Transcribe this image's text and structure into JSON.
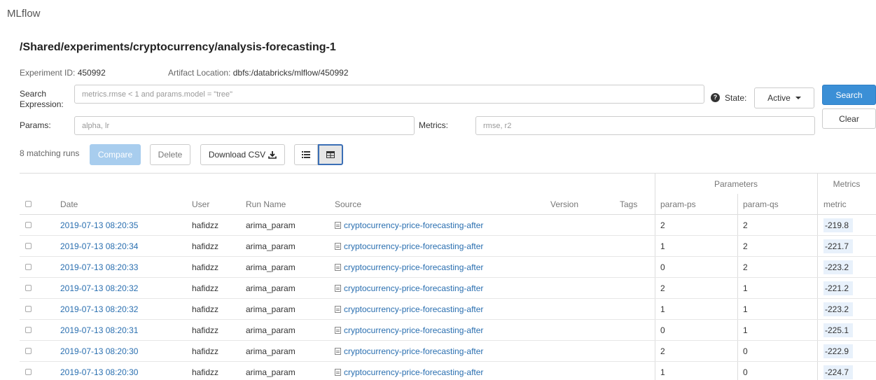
{
  "app": {
    "title": "MLflow"
  },
  "experiment": {
    "path": "/Shared/experiments/cryptocurrency/analysis-forecasting-1",
    "id_label": "Experiment ID:",
    "id_value": "450992",
    "artifact_label": "Artifact Location:",
    "artifact_value": "dbfs:/databricks/mlflow/450992"
  },
  "search": {
    "expression_label_1": "Search",
    "expression_label_2": "Expression:",
    "expression_placeholder": "metrics.rmse < 1 and params.model = \"tree\"",
    "params_label": "Params:",
    "params_placeholder": "alpha, lr",
    "metrics_label": "Metrics:",
    "metrics_placeholder": "rmse, r2",
    "state_label": "State:",
    "state_value": "Active",
    "search_button": "Search",
    "clear_button": "Clear"
  },
  "toolbar": {
    "matching_runs": "8 matching runs",
    "compare_label": "Compare",
    "delete_label": "Delete",
    "download_label": "Download CSV"
  },
  "table": {
    "group_headers": {
      "parameters": "Parameters",
      "metrics": "Metrics"
    },
    "columns": {
      "date": "Date",
      "user": "User",
      "run_name": "Run Name",
      "source": "Source",
      "version": "Version",
      "tags": "Tags",
      "param_ps": "param-ps",
      "param_qs": "param-qs",
      "metric": "metric"
    },
    "rows": [
      {
        "date": "2019-07-13 08:20:35",
        "user": "hafidzz",
        "run_name": "arima_param",
        "source": "cryptocurrency-price-forecasting-after",
        "param_ps": "2",
        "param_qs": "2",
        "metric": "-219.8"
      },
      {
        "date": "2019-07-13 08:20:34",
        "user": "hafidzz",
        "run_name": "arima_param",
        "source": "cryptocurrency-price-forecasting-after",
        "param_ps": "1",
        "param_qs": "2",
        "metric": "-221.7"
      },
      {
        "date": "2019-07-13 08:20:33",
        "user": "hafidzz",
        "run_name": "arima_param",
        "source": "cryptocurrency-price-forecasting-after",
        "param_ps": "0",
        "param_qs": "2",
        "metric": "-223.2"
      },
      {
        "date": "2019-07-13 08:20:32",
        "user": "hafidzz",
        "run_name": "arima_param",
        "source": "cryptocurrency-price-forecasting-after",
        "param_ps": "2",
        "param_qs": "1",
        "metric": "-221.2"
      },
      {
        "date": "2019-07-13 08:20:32",
        "user": "hafidzz",
        "run_name": "arima_param",
        "source": "cryptocurrency-price-forecasting-after",
        "param_ps": "1",
        "param_qs": "1",
        "metric": "-223.2"
      },
      {
        "date": "2019-07-13 08:20:31",
        "user": "hafidzz",
        "run_name": "arima_param",
        "source": "cryptocurrency-price-forecasting-after",
        "param_ps": "0",
        "param_qs": "1",
        "metric": "-225.1"
      },
      {
        "date": "2019-07-13 08:20:30",
        "user": "hafidzz",
        "run_name": "arima_param",
        "source": "cryptocurrency-price-forecasting-after",
        "param_ps": "2",
        "param_qs": "0",
        "metric": "-222.9"
      },
      {
        "date": "2019-07-13 08:20:30",
        "user": "hafidzz",
        "run_name": "arima_param",
        "source": "cryptocurrency-price-forecasting-after",
        "param_ps": "1",
        "param_qs": "0",
        "metric": "-224.7"
      }
    ]
  },
  "colors": {
    "primary": "#3b8fd6",
    "link": "#2a6fb0",
    "metric_bg": "#e8f1fb"
  }
}
